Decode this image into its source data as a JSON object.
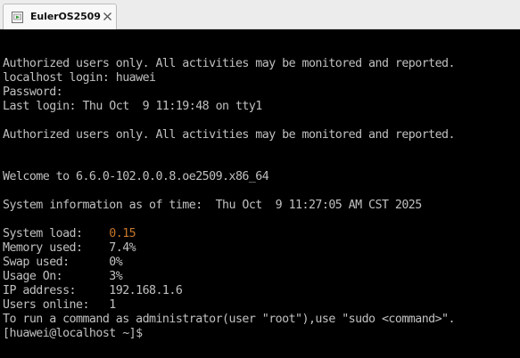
{
  "tab": {
    "title": "EulerOS2509",
    "icon": "vm-console-icon",
    "close_icon": "close-icon"
  },
  "console": {
    "banner1": "Authorized users only. All activities may be monitored and reported.",
    "login": "localhost login: huawei",
    "password": "Password:",
    "last_login": "Last login: Thu Oct  9 11:19:48 on tty1",
    "banner2": "Authorized users only. All activities may be monitored and reported.",
    "welcome": "Welcome to 6.6.0-102.0.0.8.oe2509.x86_64",
    "sysinfo": "System information as of time:  Thu Oct  9 11:27:05 AM CST 2025",
    "system_load_label": "System load:    ",
    "system_load_value": "0.15",
    "memory_used": "Memory used:    7.4%",
    "swap_used": "Swap used:      0%",
    "usage_on": "Usage On:       3%",
    "ip_address": "IP address:     192.168.1.6",
    "users_online": "Users online:   1",
    "sudo_hint": "To run a command as administrator(user \"root\"),use \"sudo <command>\".",
    "prompt": "[huawei@localhost ~]$"
  },
  "colors": {
    "terminal_bg": "#000000",
    "terminal_fg": "#c0c0c0",
    "load_value": "#c6762c",
    "tab_bg": "#f8f8f8",
    "tabstrip_bg": "#ececec"
  }
}
